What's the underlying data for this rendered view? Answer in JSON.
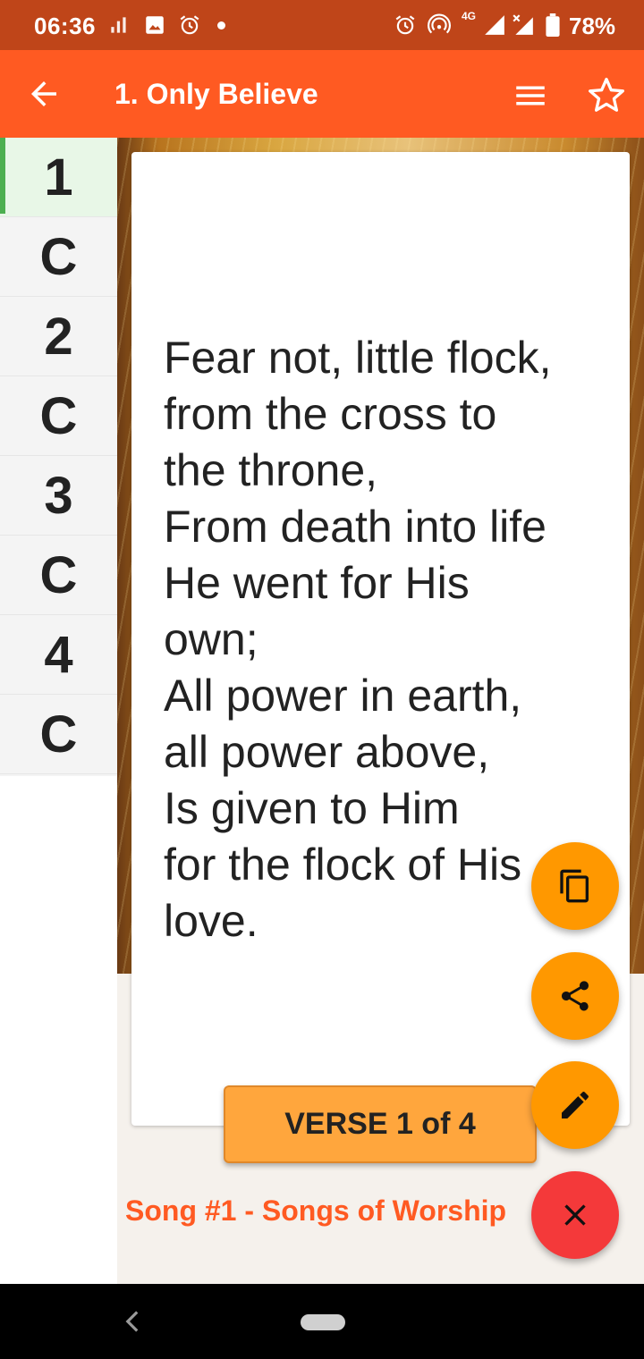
{
  "status_bar": {
    "time": "06:36",
    "network_label": "4G",
    "battery": "78%",
    "icons": [
      "media-icon",
      "image-icon",
      "alarm-icon",
      "notification-dot",
      "alarm-icon",
      "hotspot-icon",
      "signal-icon",
      "signal-x-icon",
      "battery-icon"
    ]
  },
  "app_bar": {
    "title": "1. Only Believe",
    "back_icon": "arrow-back-icon",
    "menu_icon": "menu-icon",
    "favorite_icon": "star-outline-icon"
  },
  "sidebar": {
    "items": [
      {
        "label": "1",
        "active": true
      },
      {
        "label": "C"
      },
      {
        "label": "2"
      },
      {
        "label": "C"
      },
      {
        "label": "3"
      },
      {
        "label": "C"
      },
      {
        "label": "4"
      },
      {
        "label": "C"
      }
    ],
    "active_color": "#4CAF50"
  },
  "lyrics": {
    "text": "Fear not, little flock,\nfrom the cross to\nthe throne,\nFrom death into life\nHe went for His\nown;\nAll power in earth,\nall power above,\nIs given to Him\nfor the flock of His\nlove."
  },
  "verse_indicator": {
    "label": "VERSE 1 of 4"
  },
  "source": {
    "label": "Song #1 - Songs of Worship"
  },
  "fabs": {
    "copy_icon": "copy-icon",
    "share_icon": "share-icon",
    "edit_icon": "edit-icon",
    "close_icon": "close-icon"
  },
  "colors": {
    "status_bar": "#BF4519",
    "app_bar": "#FF5A22",
    "fab_orange": "#FF9800",
    "fab_red": "#F4393A",
    "verse_button": "#FFA63D",
    "source_text": "#FF5A22"
  }
}
